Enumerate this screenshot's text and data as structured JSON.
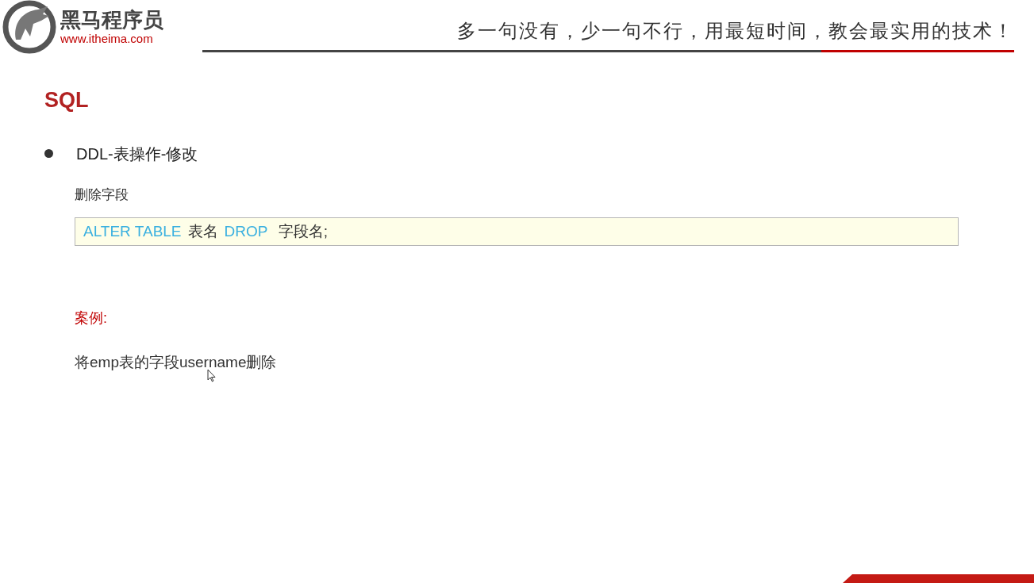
{
  "header": {
    "brand": "黑马程序员",
    "url": "www.itheima.com",
    "slogan": "多一句没有，少一句不行，用最短时间，教会最实用的技术！"
  },
  "title": "SQL",
  "bullet": "DDL-表操作-修改",
  "subtitle": "删除字段",
  "code": [
    {
      "kind": "keyword",
      "text": "ALTER TABLE"
    },
    {
      "kind": "plain",
      "text": "表名"
    },
    {
      "kind": "keyword",
      "text": "DROP"
    },
    {
      "kind": "plain",
      "text": " 字段名;"
    }
  ],
  "case_label": "案例:",
  "case_text": "将emp表的字段username删除"
}
